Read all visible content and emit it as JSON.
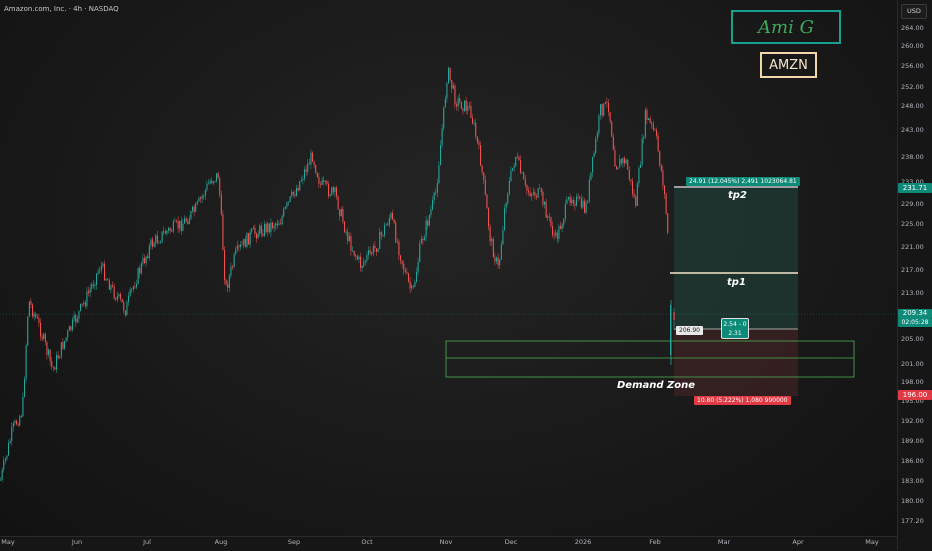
{
  "header": {
    "symbol_title": "Amazon.com, Inc. · 4h · NASDAQ"
  },
  "price_scale": {
    "currency": "USD",
    "ticks": [
      "264.00",
      "260.00",
      "256.00",
      "252.00",
      "248.00",
      "243.00",
      "238.00",
      "233.00",
      "229.00",
      "225.00",
      "221.00",
      "217.00",
      "213.00",
      "209.00",
      "205.00",
      "201.00",
      "198.00",
      "195.00",
      "192.00",
      "189.00",
      "186.00",
      "183.00",
      "180.00",
      "177.20"
    ],
    "tp2_tag": "231.71",
    "current_price": "209.34",
    "countdown": "02:05:28",
    "entry_tag": "206.90",
    "stop_tag": "196.00"
  },
  "date_axis": [
    "May",
    "Jun",
    "Jul",
    "Aug",
    "Sep",
    "Oct",
    "Nov",
    "Dec",
    "2026",
    "Feb",
    "Mar",
    "Apr",
    "May"
  ],
  "overlays": {
    "brand": "Ami G",
    "ticker": "AMZN",
    "tp2_label": "tp2",
    "tp1_label": "tp1",
    "demand_label": "Demand Zone",
    "target_stats": "24.91 (12.045%) 2,491 1023064.81",
    "stop_stats": "10.80 (5.222%) 1,080 990000",
    "position_line1": "2.54 - 0",
    "position_line2": "2.31"
  },
  "colors": {
    "bull": "#26a69a",
    "bear": "#ef5350",
    "zone": "#4caf50",
    "target_fill": "#1f3b34",
    "stop_fill": "#3b2023"
  }
}
